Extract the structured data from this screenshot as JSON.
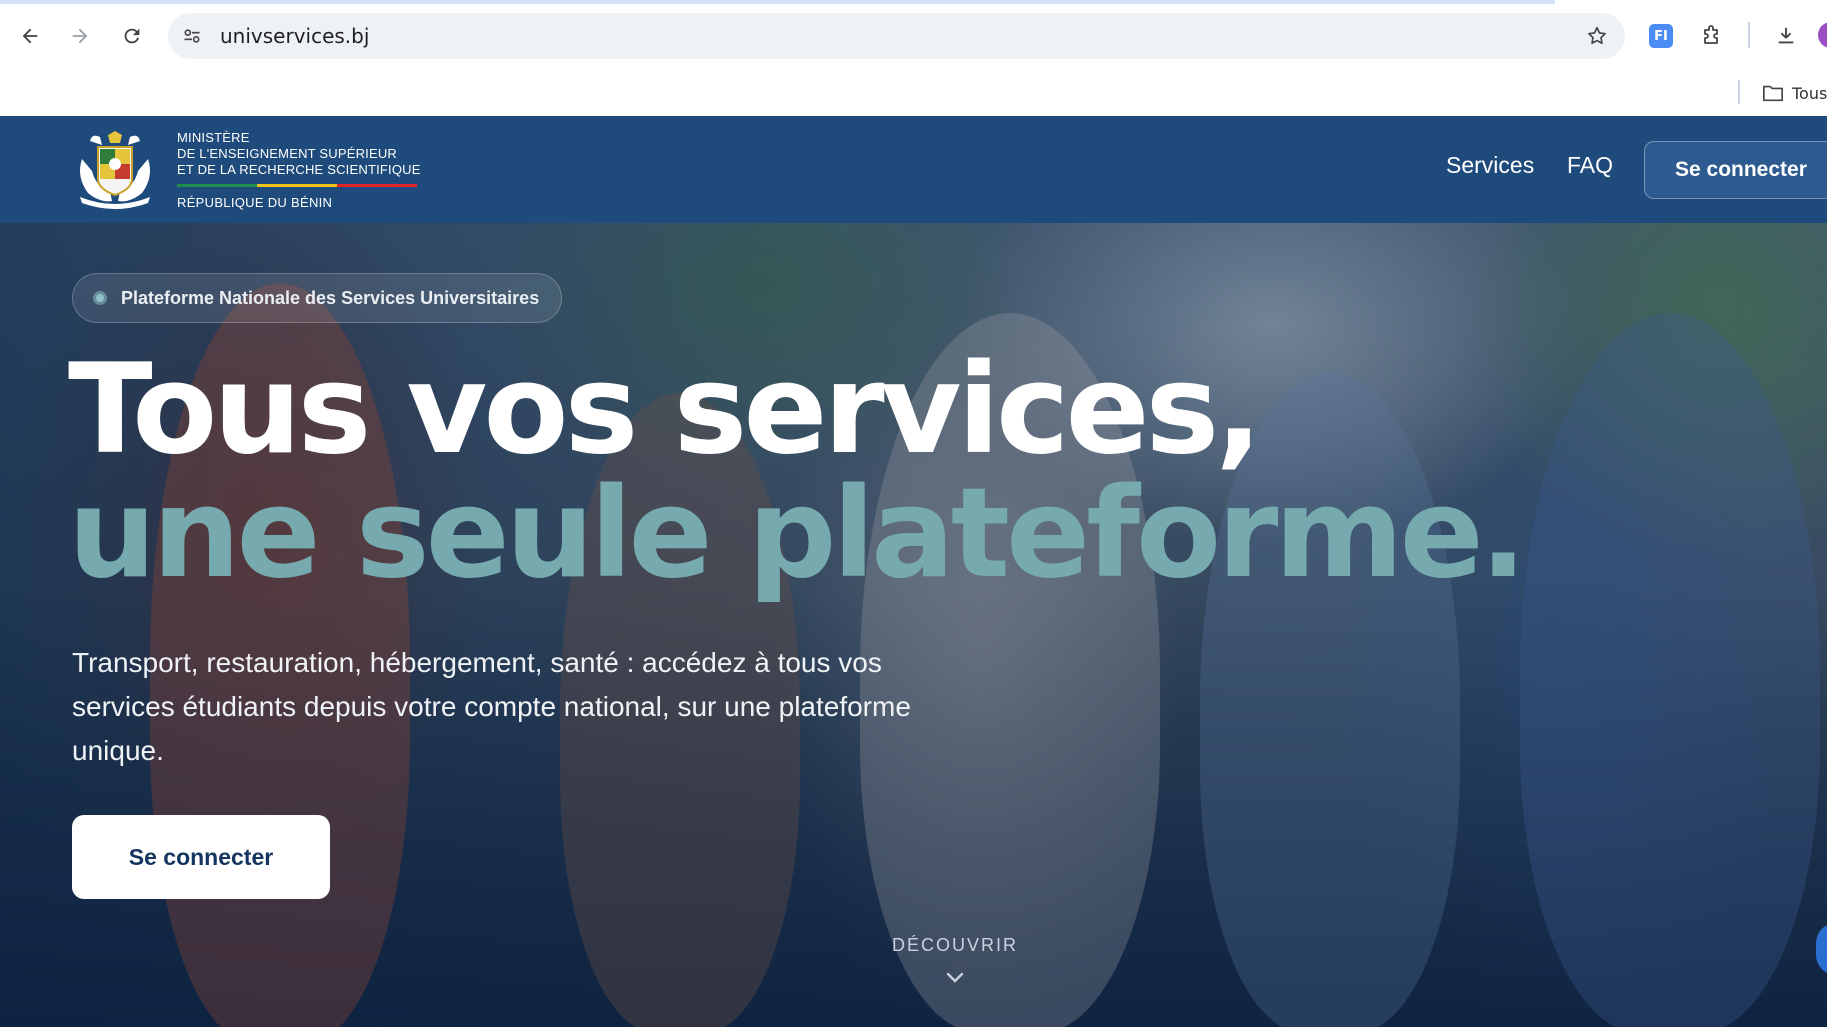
{
  "browser": {
    "url": "univservices.bj",
    "bookmark_folder": "Tous",
    "extension_label": "FI"
  },
  "header": {
    "ministry_lines": [
      "MINISTÈRE",
      "DE L'ENSEIGNEMENT SUPÉRIEUR",
      "ET DE LA RECHERCHE SCIENTIFIQUE"
    ],
    "country": "RÉPUBLIQUE DU BÉNIN",
    "flag_colors": [
      "#1e8f4a",
      "#f2c318",
      "#e2242b"
    ],
    "nav": {
      "services": "Services",
      "faq": "FAQ",
      "login": "Se connecter"
    }
  },
  "hero": {
    "badge": "Plateforme Nationale des Services Universitaires",
    "headline_line1": "Tous vos services,",
    "headline_line2": "une seule plateforme.",
    "lead": "Transport, restauration, hébergement, santé : accédez à tous vos services étudiants depuis votre compte national, sur une plateforme unique.",
    "cta": "Se connecter",
    "discover": "DÉCOUVRIR"
  },
  "colors": {
    "header_bg": "#1f4a7c",
    "accent_teal": "#76aaae",
    "cta_text": "#13355f"
  }
}
